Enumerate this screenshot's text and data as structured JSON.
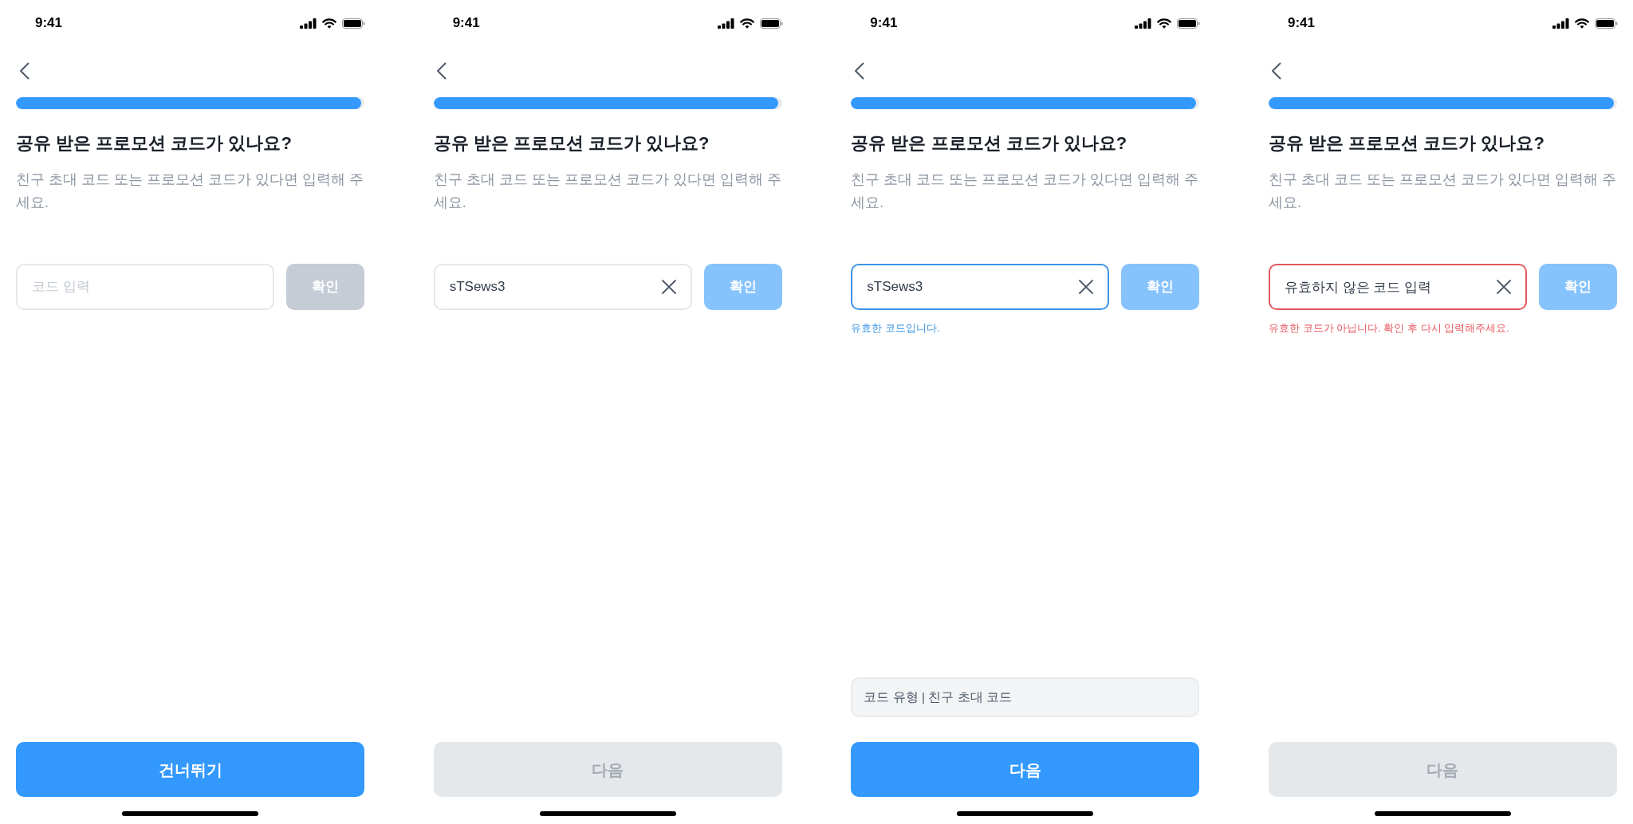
{
  "screens": [
    {
      "status_bar": {
        "time": "9:41"
      },
      "progress": {
        "level": 0.99
      },
      "title": "공유 받은 프로모션 코드가 있나요?",
      "subtitle": "친구 초대 코드 또는 프로모션 코드가 있다면 입력해 주세요.",
      "code_field": {
        "placeholder": "코드 입력",
        "valid": false,
        "error": false
      },
      "confirm_button": {
        "label": "확인",
        "disabled": true
      },
      "bottom_button": {
        "label": "건너뛰기",
        "disabled": false
      }
    },
    {
      "status_bar": {
        "time": "9:41"
      },
      "progress": {
        "level": 0.99
      },
      "title": "공유 받은 프로모션 코드가 있나요?",
      "subtitle": "친구 초대 코드 또는 프로모션 코드가 있다면 입력해 주세요.",
      "code_field": {
        "value": "sTSews3",
        "valid": false,
        "error": false
      },
      "confirm_button": {
        "label": "확인",
        "disabled": false
      },
      "bottom_button": {
        "label": "다음",
        "disabled": true
      }
    },
    {
      "status_bar": {
        "time": "9:41"
      },
      "progress": {
        "level": 0.99
      },
      "title": "공유 받은 프로모션 코드가 있나요?",
      "subtitle": "친구 초대 코드 또는 프로모션 코드가 있다면 입력해 주세요.",
      "code_field": {
        "value": "sTSews3",
        "valid": true,
        "error": false,
        "message": "유효한 코드입니다."
      },
      "confirm_button": {
        "label": "확인",
        "disabled": false
      },
      "code_type": "코드 유형 | 친구 초대 코드",
      "bottom_button": {
        "label": "다음",
        "disabled": false
      }
    },
    {
      "status_bar": {
        "time": "9:41"
      },
      "progress": {
        "level": 0.99
      },
      "title": "공유 받은 프로모션 코드가 있나요?",
      "subtitle": "친구 초대 코드 또는 프로모션 코드가 있다면 입력해 주세요.",
      "code_field": {
        "value": "유효하지 않은 코드 입력",
        "valid": false,
        "error": true,
        "message": "유효한 코드가 아닙니다. 확인 후 다시 입력해주세요."
      },
      "confirm_button": {
        "label": "확인",
        "disabled": false
      },
      "bottom_button": {
        "label": "다음",
        "disabled": true
      }
    }
  ]
}
